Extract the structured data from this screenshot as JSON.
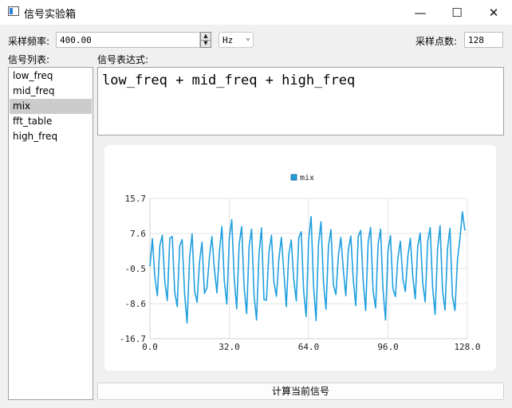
{
  "window": {
    "title": "信号实验箱",
    "controls": [
      "minimize-icon",
      "maximize-icon",
      "close-icon"
    ]
  },
  "toolbar": {
    "sample_rate_label": "采样频率:",
    "sample_rate_value": "400.00",
    "unit_selected": "Hz",
    "points_label": "采样点数:",
    "points_value": "128"
  },
  "signal_list": {
    "label": "信号列表:",
    "items": [
      "low_freq",
      "mid_freq",
      "mix",
      "fft_table",
      "high_freq"
    ],
    "selected": "mix"
  },
  "expression": {
    "label": "信号表达式:",
    "value": "low_freq + mid_freq + high_freq"
  },
  "compute_button": "计算当前信号",
  "colors": {
    "series": "#209fdf",
    "selection": "#cccccc"
  },
  "chart_data": {
    "type": "line",
    "legend": "top-center",
    "grid": true,
    "series": [
      {
        "name": "mix",
        "x": [
          0,
          1,
          2,
          3,
          4,
          5,
          6,
          7,
          8,
          9,
          10,
          11,
          12,
          13,
          14,
          15,
          16,
          17,
          18,
          19,
          20,
          21,
          22,
          23,
          24,
          25,
          26,
          27,
          28,
          29,
          30,
          31,
          32,
          33,
          34,
          35,
          36,
          37,
          38,
          39,
          40,
          41,
          42,
          43,
          44,
          45,
          46,
          47,
          48,
          49,
          50,
          51,
          52,
          53,
          54,
          55,
          56,
          57,
          58,
          59,
          60,
          61,
          62,
          63,
          64,
          65,
          66,
          67,
          68,
          69,
          70,
          71,
          72,
          73,
          74,
          75,
          76,
          77,
          78,
          79,
          80,
          81,
          82,
          83,
          84,
          85,
          86,
          87,
          88,
          89,
          90,
          91,
          92,
          93,
          94,
          95,
          96,
          97,
          98,
          99,
          100,
          101,
          102,
          103,
          104,
          105,
          106,
          107,
          108,
          109,
          110,
          111,
          112,
          113,
          114,
          115,
          116,
          117,
          118,
          119,
          120,
          121,
          122,
          123,
          124,
          125,
          126,
          127
        ],
        "values": [
          0,
          6.4,
          -2.4,
          -6.8,
          4.8,
          7.2,
          -3.6,
          -7.9,
          6.5,
          6.9,
          -5.9,
          -9.3,
          4.7,
          6.2,
          -6.4,
          -13.1,
          2.2,
          7.5,
          -5.6,
          -8.3,
          1.1,
          5.6,
          -6.2,
          -4.9,
          2.1,
          6.9,
          -0.6,
          -6.1,
          3.2,
          9.2,
          -3.5,
          -8.7,
          6.5,
          10.8,
          -2.8,
          -9.8,
          5.1,
          9.2,
          -5.1,
          -10.9,
          4.7,
          8.6,
          -6.8,
          -12.4,
          2.9,
          8.9,
          -7.7,
          -7.8,
          3.4,
          7.2,
          -3.7,
          -6.9,
          1.7,
          6.7,
          -1.2,
          -9.3,
          2.7,
          6.1,
          -2.9,
          -8.0,
          6.6,
          8.0,
          -5.8,
          -11.6,
          6.1,
          11.5,
          -4.7,
          -12.5,
          5.2,
          10.3,
          -3.9,
          -9.9,
          4.8,
          8.5,
          -4.3,
          -6.5,
          2.5,
          6.7,
          -0.8,
          -6.8,
          3.9,
          7.0,
          -3.2,
          -9.1,
          6.9,
          8.3,
          -3.3,
          -10.2,
          5.6,
          9.0,
          -5.6,
          -9.6,
          5.1,
          8.6,
          -5.4,
          -12.4,
          3.6,
          7.1,
          -5.2,
          -7.0,
          1.9,
          5.8,
          -2.9,
          -5.8,
          2.3,
          6.5,
          -2.4,
          -7.5,
          4.6,
          7.7,
          -3.7,
          -8.2,
          5.7,
          9.0,
          -5.0,
          -11.1,
          3.9,
          9.4,
          -5.6,
          -10.1,
          4.0,
          8.8,
          -6.9,
          -10.2,
          1.5,
          6.3,
          12.6,
          8.3
        ]
      }
    ],
    "x_ticks": [
      "0.0",
      "32.0",
      "64.0",
      "96.0",
      "128.0"
    ],
    "y_ticks": [
      "15.7",
      "7.6",
      "-0.5",
      "-8.6",
      "-16.7"
    ],
    "xlim": [
      0,
      128
    ],
    "ylim": [
      -16.7,
      15.7
    ]
  }
}
